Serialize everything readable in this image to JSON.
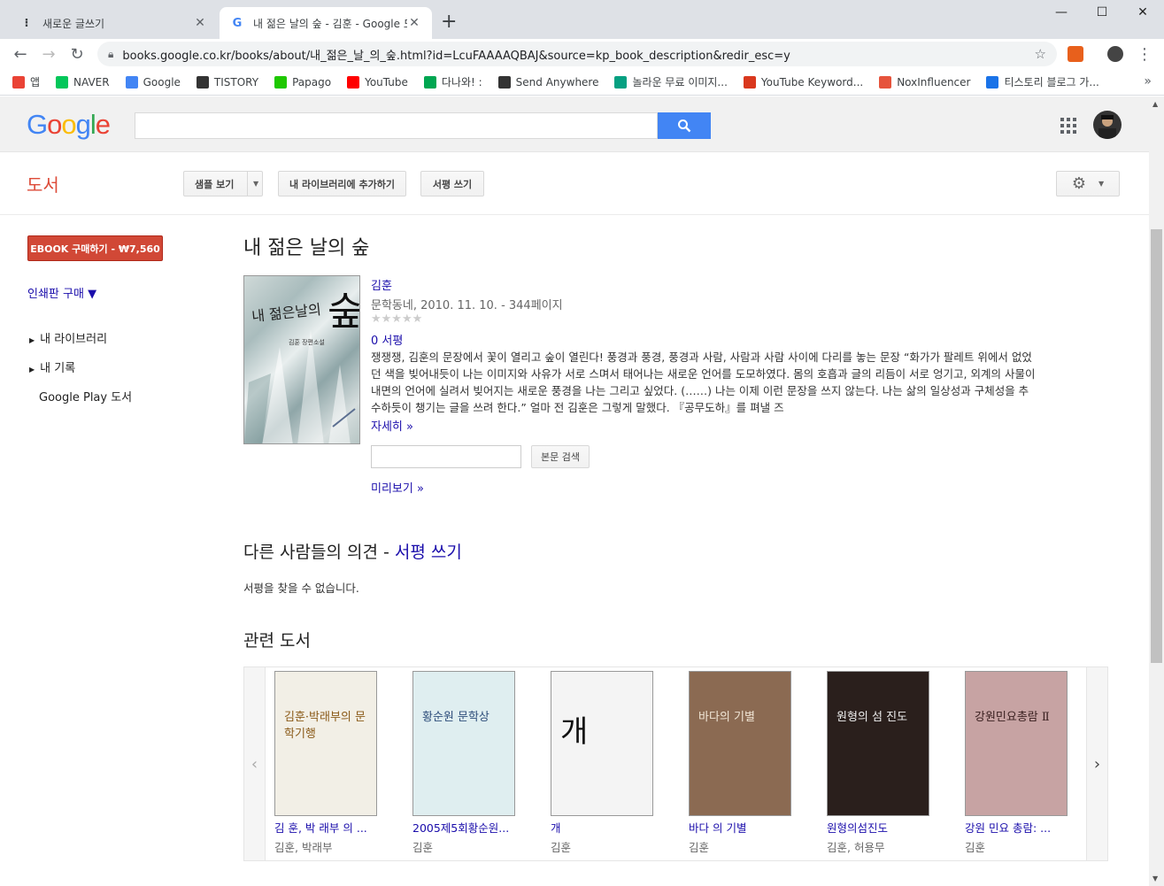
{
  "browser": {
    "tabs": [
      {
        "title": "새로운 글쓰기",
        "icon": "tistory-icon"
      },
      {
        "title": "내 젊은 날의 숲 - 김훈 - Google 도서",
        "icon": "google-icon"
      }
    ],
    "url": "books.google.co.kr/books/about/내_젊은_날_의_숲.html?id=LcuFAAAAQBAJ&source=kp_book_description&redir_esc=y",
    "bookmarks": [
      {
        "label": "앱",
        "color": "#ea4335"
      },
      {
        "label": "NAVER",
        "color": "#03c75a"
      },
      {
        "label": "Google",
        "color": "#4285f4"
      },
      {
        "label": "TISTORY",
        "color": "#333333"
      },
      {
        "label": "Papago",
        "color": "#1ec800"
      },
      {
        "label": "YouTube",
        "color": "#ff0000"
      },
      {
        "label": "다나와! :",
        "color": "#00a651"
      },
      {
        "label": "Send Anywhere",
        "color": "#333333"
      },
      {
        "label": "놀라운 무료 이미지...",
        "color": "#05a081"
      },
      {
        "label": "YouTube Keyword...",
        "color": "#d9381e"
      },
      {
        "label": "NoxInfluencer",
        "color": "#e6533c"
      },
      {
        "label": "티스토리 블로그 가...",
        "color": "#1a73e8"
      }
    ]
  },
  "google": {
    "logo": "Google"
  },
  "books": {
    "section_title": "도서",
    "toolbar": {
      "sample_label": "샘플 보기",
      "add_library_label": "내 라이브러리에 추가하기",
      "write_review_label": "서평 쓰기"
    },
    "left": {
      "buy_label": "EBOOK 구매하기 - ₩7,560",
      "print_label": "인쇄판 구매 ▼",
      "nav": [
        "내 라이브러리",
        "내 기록",
        "Google Play 도서"
      ]
    },
    "book": {
      "title": "내 젊은 날의 숲",
      "cover_text": "내 젊은날의",
      "cover_big": "숲",
      "cover_sub": "김훈 장편소설",
      "author": "김훈",
      "meta": "문학동네, 2010. 11. 10. - 344페이지",
      "stars": "★★★★★",
      "rating": 0,
      "reviews": "0 서평",
      "description": "쟁쟁쟁,  김훈의 문장에서 꽃이 열리고 숲이 열린다!  풍경과 풍경, 풍경과 사람, 사람과 사람 사이에 다리를 놓는 문장  “화가가 팔레트 위에서 없었던 색을 빚어내듯이 나는 이미지와 사유가 서로 스며서 태어나는 새로운 언어를 도모하였다. 몸의 호흡과 글의 리듬이 서로 엉기고, 외계의 사물이 내면의 언어에 실려서 빚어지는 새로운 풍경을 나는 그리고 싶었다. (……) 나는 이제 이런 문장을 쓰지 않는다. 나는 삶의 일상성과 구체성을 추수하듯이 챙기는 글을 쓰려 한다.”  얼마 전 김훈은 그렇게 말했다. 『공무도하』를 펴낼 즈",
      "more_label": "자세히 »",
      "inner_search_button": "본문 검색",
      "preview_label": "미리보기 »"
    },
    "opinions": {
      "title": "다른 사람들의 의견 - ",
      "write_link": "서평 쓰기",
      "empty": "서평을 찾을 수 없습니다."
    },
    "related": {
      "title": "관련 도서",
      "items": [
        {
          "title": "김 훈, 박 래부 의 ...",
          "authors": "김훈, 박래부",
          "cover_label": "김훈·박래부의 문학기행"
        },
        {
          "title": "2005제5회황순원...",
          "authors": "김훈",
          "cover_label": "황순원 문학상"
        },
        {
          "title": "개",
          "authors": "김훈",
          "cover_label": "개"
        },
        {
          "title": "바다 의 기별",
          "authors": "김훈",
          "cover_label": "바다의 기별"
        },
        {
          "title": "원형의섬진도",
          "authors": "김훈, 허용무",
          "cover_label": "원형의 섬 진도"
        },
        {
          "title": "강원 민요 총람: ...",
          "authors": "김훈",
          "cover_label": "강원민요총람 Ⅱ"
        }
      ]
    }
  }
}
